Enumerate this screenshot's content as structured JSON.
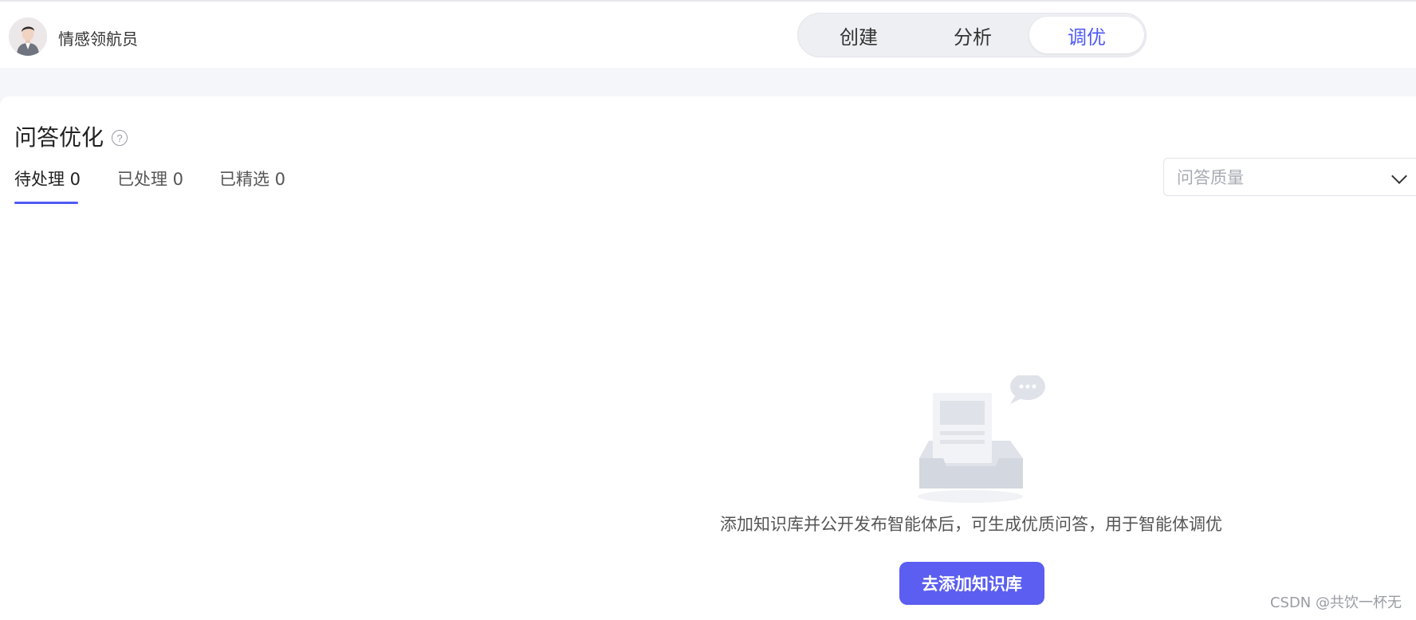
{
  "header": {
    "agent_name": "情感领航员",
    "modes": [
      {
        "label": "创建",
        "active": false
      },
      {
        "label": "分析",
        "active": false
      },
      {
        "label": "调优",
        "active": true
      }
    ]
  },
  "section": {
    "title": "问答优化",
    "help_icon": "question-circle-icon",
    "tabs": [
      {
        "label": "待处理 0",
        "active": true
      },
      {
        "label": "已处理 0",
        "active": false
      },
      {
        "label": "已精选 0",
        "active": false
      }
    ],
    "filter": {
      "placeholder": "问答质量",
      "icon": "chevron-down-icon"
    }
  },
  "empty_state": {
    "icon": "empty-inbox-icon",
    "message": "添加知识库并公开发布智能体后，可生成优质问答，用于智能体调优",
    "button_label": "去添加知识库"
  },
  "watermark": "CSDN @共饮一杯无",
  "colors": {
    "accent": "#4f5af5",
    "button": "#5b5ef0",
    "page_bg": "#f5f6f9"
  }
}
